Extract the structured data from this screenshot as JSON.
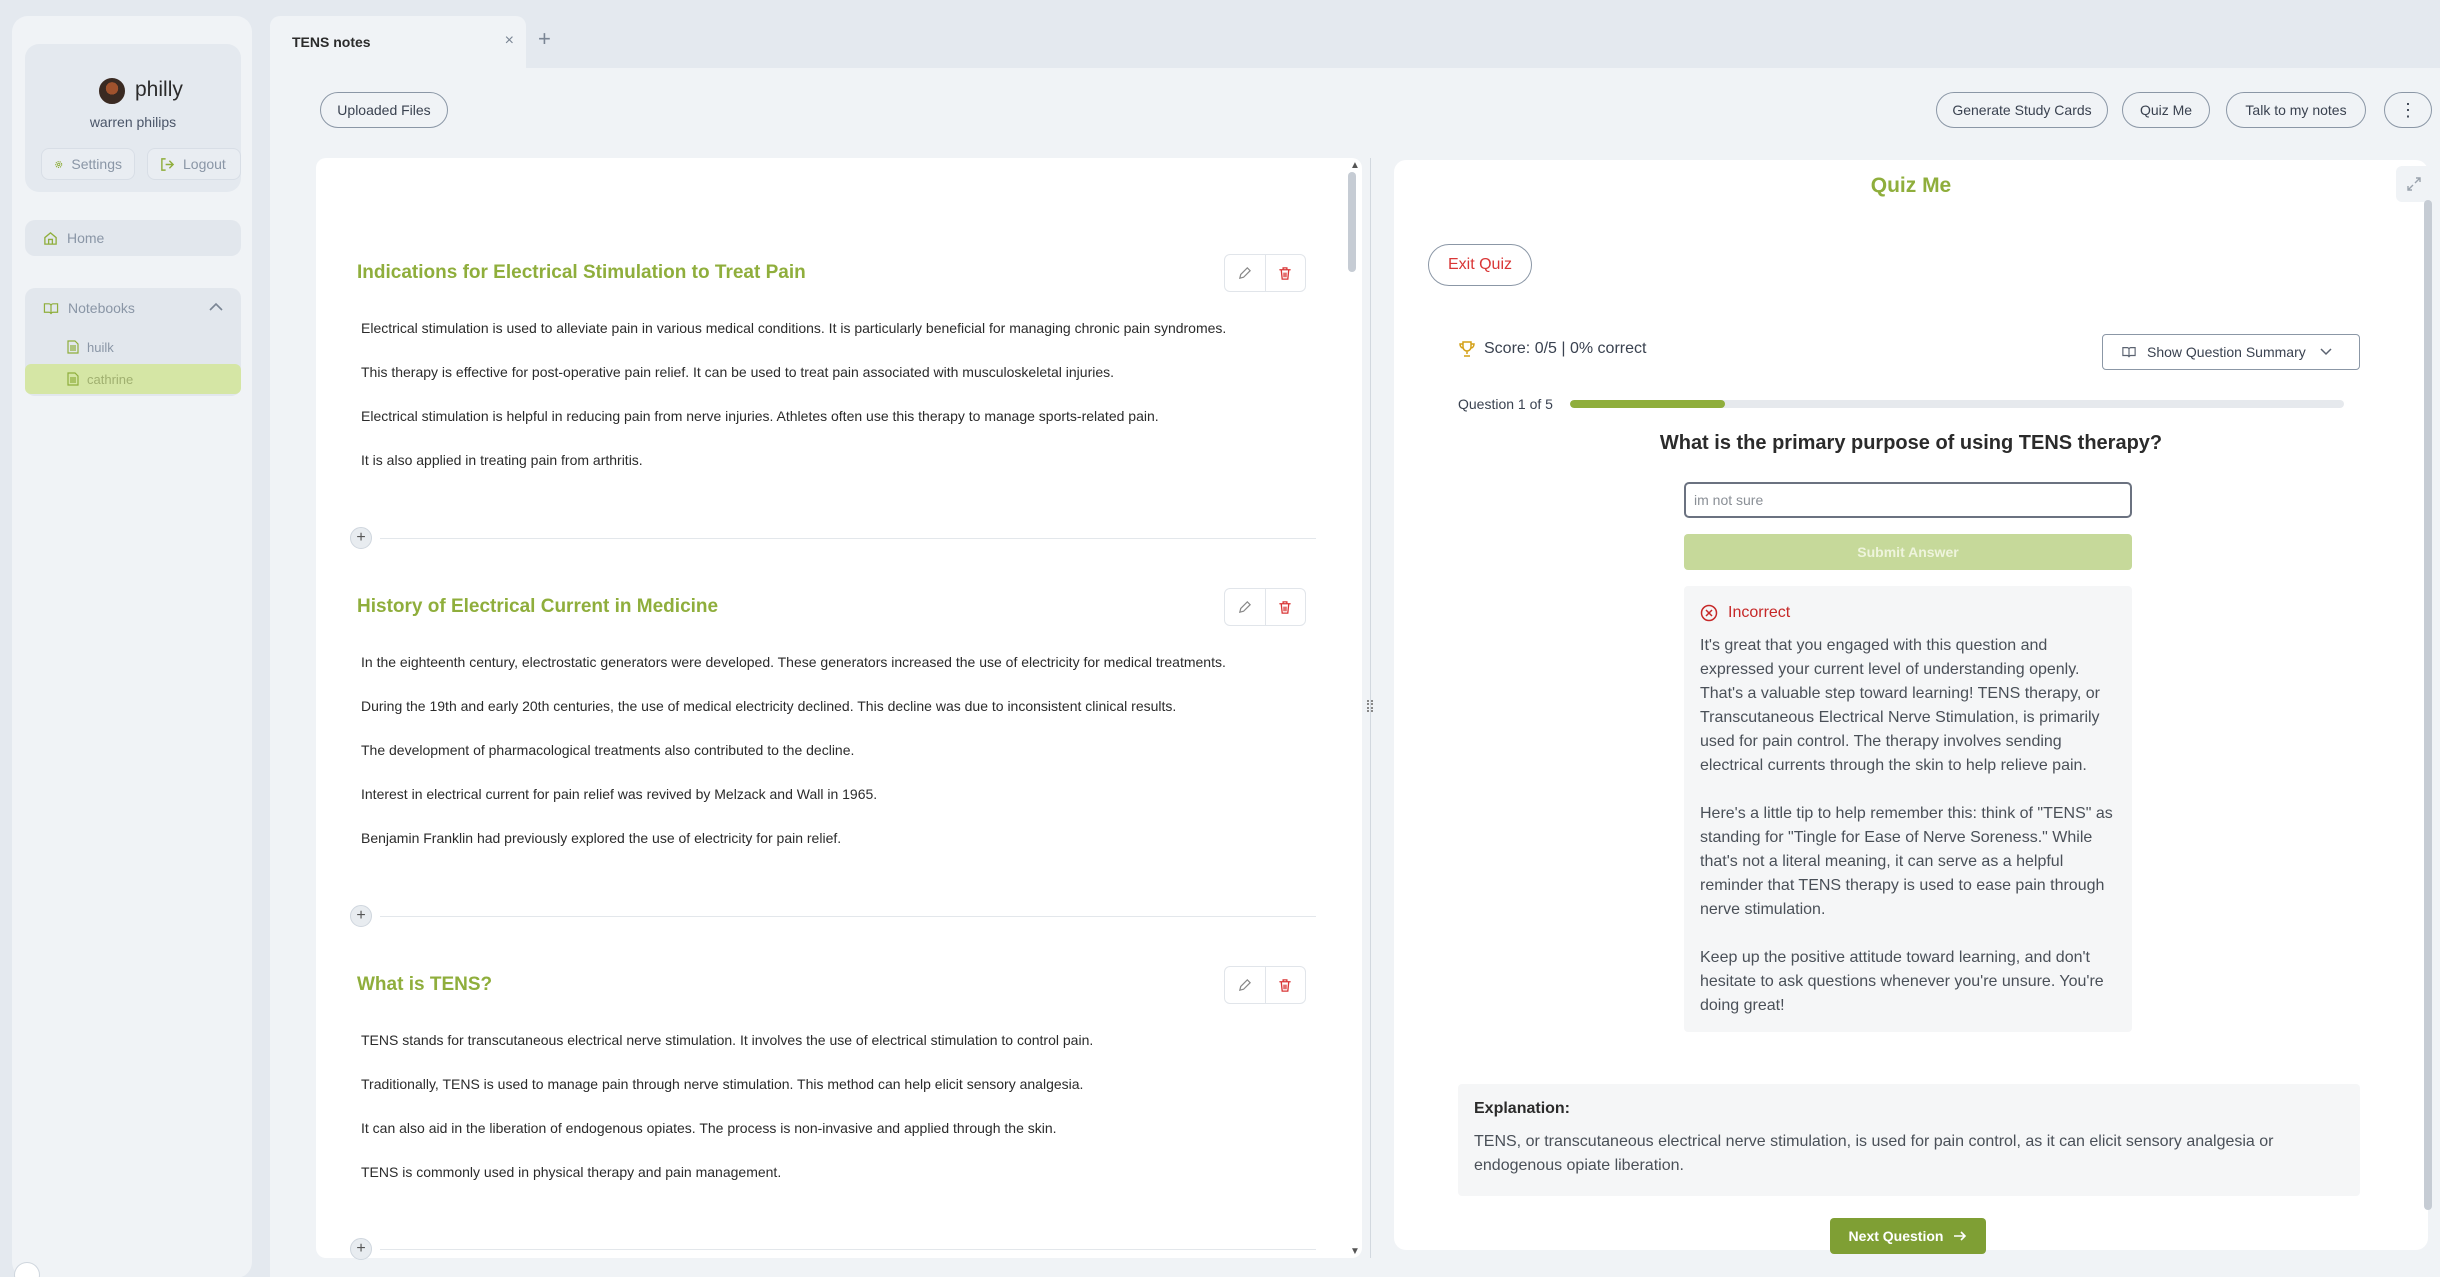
{
  "sidebar": {
    "user_name": "philly",
    "user_full_name": "warren philips",
    "settings_label": "Settings",
    "logout_label": "Logout",
    "home_label": "Home",
    "notebooks_label": "Notebooks",
    "notebooks": [
      {
        "label": "huilk",
        "active": false
      },
      {
        "label": "cathrine",
        "active": true
      }
    ]
  },
  "tabs": [
    {
      "label": "TENS notes",
      "close": "×"
    }
  ],
  "tab_add": "+",
  "toolbar": {
    "uploaded_files": "Uploaded Files",
    "generate_study_cards": "Generate Study Cards",
    "quiz_me": "Quiz Me",
    "talk_to_notes": "Talk to my notes",
    "more": "⋮"
  },
  "notes": {
    "sections": [
      {
        "title": "Indications for Electrical Stimulation to Treat Pain",
        "paragraphs": [
          "Electrical stimulation is used to alleviate pain in various medical conditions.  It is particularly beneficial for managing chronic pain syndromes.",
          "This therapy is effective for post-operative pain relief.  It can be used to treat pain associated with musculoskeletal injuries.",
          "Electrical stimulation is helpful in reducing pain from nerve injuries.  Athletes often use this therapy to manage sports-related pain.",
          "It is also applied in treating pain from arthritis."
        ]
      },
      {
        "title": "History of Electrical Current in Medicine",
        "paragraphs": [
          "In the eighteenth century, electrostatic generators were developed.  These generators increased the use of electricity for medical treatments.",
          "During the 19th and early 20th centuries, the use of medical electricity declined.  This decline was due to inconsistent clinical results.",
          "The development of pharmacological treatments also contributed to the decline.",
          "Interest in electrical current for pain relief was revived by Melzack and Wall in 1965.",
          "Benjamin Franklin had previously explored the use of electricity for pain relief."
        ]
      },
      {
        "title": "What is TENS?",
        "paragraphs": [
          "TENS stands for transcutaneous electrical nerve stimulation.  It involves the use of electrical stimulation to control pain.",
          "Traditionally, TENS is used to manage pain through nerve stimulation.  This method can help elicit sensory analgesia.",
          "It can also aid in the liberation of endogenous opiates.  The process is non-invasive and applied through the skin.",
          "TENS is commonly used in physical therapy and pain management."
        ]
      }
    ],
    "add_symbol": "+"
  },
  "quiz": {
    "title": "Quiz Me",
    "exit_label": "Exit Quiz",
    "score_text": "Score: 0/5 | 0% correct",
    "summary_label": "Show Question Summary",
    "question_count": "Question 1 of 5",
    "progress_fraction": 0.2,
    "question": "What is the primary purpose of using TENS therapy?",
    "answer_value": "im not sure",
    "submit_label": "Submit Answer",
    "feedback_status": "Incorrect",
    "feedback_paragraphs": [
      "It's great that you engaged with this question and expressed your current level of understanding openly. That's a valuable step toward learning! TENS therapy, or Transcutaneous Electrical Nerve Stimulation, is primarily used for pain control. The therapy involves sending electrical currents through the skin to help relieve pain.",
      "Here's a little tip to help remember this: think of \"TENS\" as standing for \"Tingle for Ease of Nerve Soreness.\" While that's not a literal meaning, it can serve as a helpful reminder that TENS therapy is used to ease pain through nerve stimulation.",
      "Keep up the positive attitude toward learning, and don't hesitate to ask questions whenever you're unsure. You're doing great!"
    ],
    "explanation_label": "Explanation:",
    "explanation_text": "TENS, or transcutaneous electrical nerve stimulation, is used for pain control, as it can elicit sensory analgesia or endogenous opiate liberation.",
    "next_label": "Next Question"
  },
  "colors": {
    "accent": "#8fae3c",
    "danger": "#d93636",
    "active_notebook": "#d5e6a5"
  },
  "icons": [
    "gear-icon",
    "logout-icon",
    "home-icon",
    "book-icon",
    "chevron-up-icon",
    "file-icon",
    "close-icon",
    "plus-icon",
    "pencil-icon",
    "trash-icon",
    "expand-icon",
    "trophy-icon",
    "chevron-down-icon",
    "x-circle-icon",
    "arrow-right-icon"
  ]
}
